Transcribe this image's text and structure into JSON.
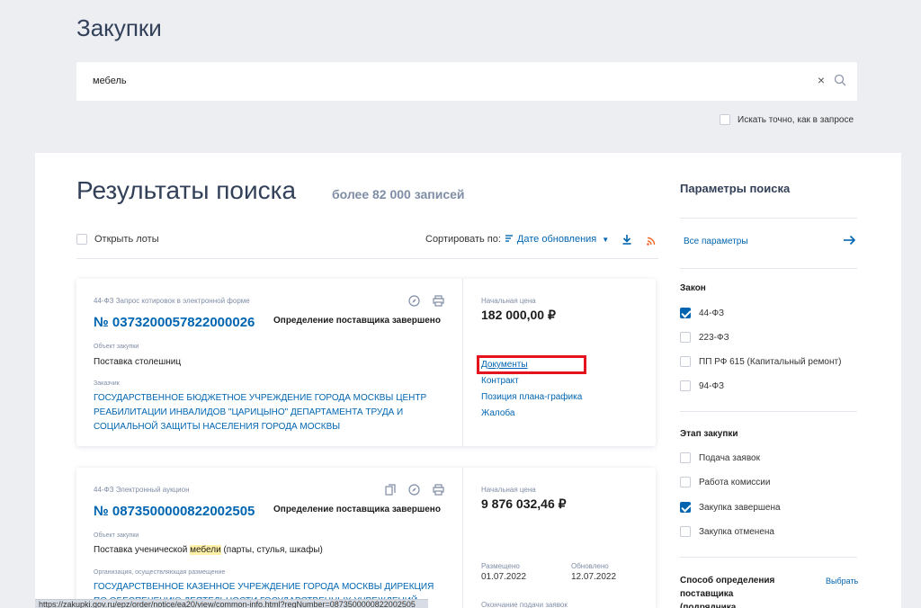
{
  "header": {
    "title": "Закупки"
  },
  "search": {
    "value": "мебель",
    "clear": "×",
    "exact_label": "Искать точно, как в запросе"
  },
  "results": {
    "title": "Результаты поиска",
    "count": "более 82 000 записей",
    "open_lots": "Открыть лоты",
    "sort_label": "Сортировать по:",
    "sort_value": "Дате обновления"
  },
  "cards": [
    {
      "type": "44-ФЗ Запрос котировок в электронной форме",
      "number": "№ 0373200057822000026",
      "status": "Определение поставщика завершено",
      "object_label": "Объект закупки",
      "object": "Поставка столешниц",
      "customer_label": "Заказчик",
      "customer": "ГОСУДАРСТВЕННОЕ БЮДЖЕТНОЕ УЧРЕЖДЕНИЕ ГОРОДА МОСКВЫ ЦЕНТР РЕАБИЛИТАЦИИ ИНВАЛИДОВ \"ЦАРИЦЫНО\" ДЕПАРТАМЕНТА ТРУДА И СОЦИАЛЬНОЙ ЗАЩИТЫ НАСЕЛЕНИЯ ГОРОДА МОСКВЫ",
      "price_label": "Начальная цена",
      "price": "182 000,00 ₽",
      "links": [
        "Документы",
        "Контракт",
        "Позиция плана-графика",
        "Жалоба"
      ]
    },
    {
      "type": "44-ФЗ Электронный аукцион",
      "number": "№ 0873500000822002505",
      "status": "Определение поставщика завершено",
      "object_label": "Объект закупки",
      "object_pre": "Поставка ученической ",
      "object_mark": "мебели",
      "object_post": " (парты, стулья, шкафы)",
      "customer_label": "Организация, осуществляющая размещение",
      "customer": "ГОСУДАРСТВЕННОЕ КАЗЕННОЕ УЧРЕЖДЕНИЕ ГОРОДА МОСКВЫ ДИРЕКЦИЯ ПО ОБЕСПЕЧЕНИЮ ДЕЯТЕЛЬНОСТИ ГОСУДАРСТВЕННЫХ УЧРЕЖДЕНИЙ",
      "price_label": "Начальная цена",
      "price": "9 876 032,46 ₽",
      "placed_label": "Размещено",
      "placed": "01.07.2022",
      "updated_label": "Обновлено",
      "updated": "12.07.2022",
      "deadline_label": "Окончание подачи заявок"
    }
  ],
  "sidebar": {
    "title": "Параметры поиска",
    "all_params": "Все параметры",
    "law_title": "Закон",
    "law_options": [
      {
        "label": "44-ФЗ",
        "checked": true
      },
      {
        "label": "223-ФЗ",
        "checked": false
      },
      {
        "label": "ПП РФ 615 (Капитальный ремонт)",
        "checked": false
      },
      {
        "label": "94-ФЗ",
        "checked": false
      }
    ],
    "stage_title": "Этап закупки",
    "stage_options": [
      {
        "label": "Подача заявок",
        "checked": false
      },
      {
        "label": "Работа комиссии",
        "checked": false
      },
      {
        "label": "Закупка завершена",
        "checked": true
      },
      {
        "label": "Закупка отменена",
        "checked": false
      }
    ],
    "method_title": "Способ определения поставщика (подрядчика,",
    "choose": "Выбрать"
  },
  "status_bar": {
    "text": "https://zakupki.gov.ru/epz/order/notice/ea20/view/common-info.html?regNumber=0873500000822002505"
  },
  "colors": {
    "accent": "#0065b1",
    "highlight_box": "#e4131e",
    "page_bg": "#eceef2"
  }
}
